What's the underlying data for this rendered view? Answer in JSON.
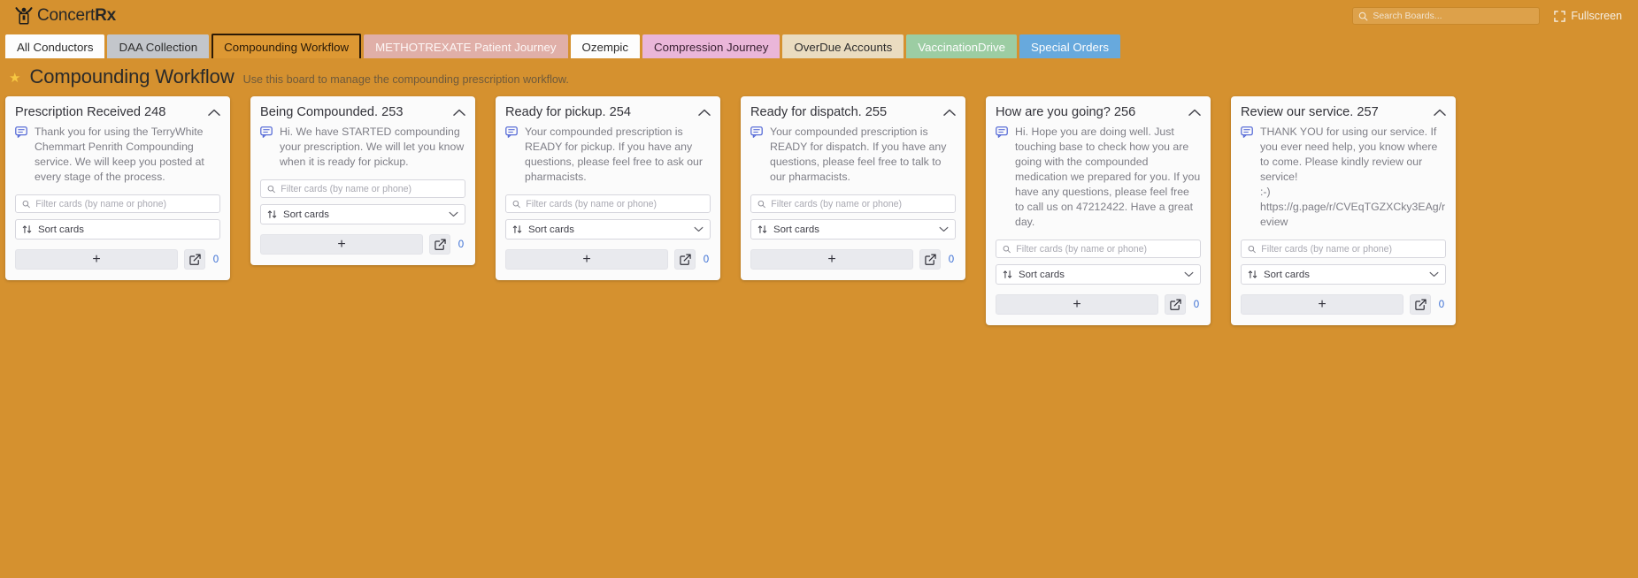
{
  "app": {
    "brand_prefix": "Concert",
    "brand_suffix": "Rx",
    "logo_icon": "person-raising-arms-logo"
  },
  "header": {
    "search": {
      "placeholder": "Search Boards...",
      "value": "",
      "icon": "search-icon"
    },
    "fullscreen": {
      "label": "Fullscreen",
      "icon": "fullscreen-icon"
    }
  },
  "tabs": [
    {
      "label": "All Conductors",
      "bg": "#fdfdfd",
      "fg": "#2d2d2d",
      "active": false
    },
    {
      "label": "DAA Collection",
      "bg": "#c3c6cb",
      "fg": "#2d2d2d",
      "active": false
    },
    {
      "label": "Compounding Workflow",
      "bg": "#dd9833",
      "fg": "#2a1a07",
      "active": true
    },
    {
      "label": "METHOTREXATE Patient Journey",
      "bg": "#e0afa8",
      "fg": "#fdf7f6",
      "active": false
    },
    {
      "label": "Ozempic",
      "bg": "#fdfdfd",
      "fg": "#2d2d2d",
      "active": false
    },
    {
      "label": "Compression Journey",
      "bg": "#eab6d9",
      "fg": "#3a2233",
      "active": false
    },
    {
      "label": "OverDue Accounts",
      "bg": "#eadcc0",
      "fg": "#2d2d2d",
      "active": false
    },
    {
      "label": "VaccinationDrive",
      "bg": "#9ccda3",
      "fg": "#fdfdfd",
      "active": false
    },
    {
      "label": "Special Orders",
      "bg": "#67a9dd",
      "fg": "#fdfdfd",
      "active": false
    }
  ],
  "board": {
    "star_icon": "star-icon",
    "title": "Compounding Workflow",
    "subtitle": "Use this board to manage the compounding prescription workflow."
  },
  "common": {
    "filter_placeholder": "Filter cards (by name or phone)",
    "sort_label": "Sort cards",
    "add_icon": "plus-icon",
    "edit_icon": "edit-square-icon",
    "collapse_icon": "chevron-up-icon",
    "message_icon": "speech-bubble-icon",
    "filter_icon": "search-icon",
    "sort_icon": "sort-arrows-icon",
    "chevron_icon": "chevron-down-icon",
    "accent_count_color": "#3b6fd4"
  },
  "columns": [
    {
      "title": "Prescription Received 248",
      "message": "Thank you for using the TerryWhite Chemmart Penrith Compounding service. We will keep you posted at every stage of the process.",
      "filter_value": "",
      "count": "0",
      "has_sort_chevron": false
    },
    {
      "title": "Being Compounded. 253",
      "message": "Hi. We have STARTED compounding your prescription. We will let you know when it is ready for pickup.",
      "filter_value": "",
      "count": "0",
      "has_sort_chevron": true
    },
    {
      "title": "Ready for pickup. 254",
      "message": "Your compounded prescription is READY for pickup. If you have any questions, please feel free to ask our pharmacists.",
      "filter_value": "",
      "count": "0",
      "has_sort_chevron": true
    },
    {
      "title": "Ready for dispatch. 255",
      "message": "Your compounded prescription is READY for dispatch. If you have any questions, please feel free to talk to our pharmacists.",
      "filter_value": "",
      "count": "0",
      "has_sort_chevron": true
    },
    {
      "title": "How are you going? 256",
      "message": "Hi. Hope you are doing well. Just touching base to check how you are going with the compounded medication we prepared for you. If you have any questions, please feel free to call us on 47212422. Have a great day.",
      "filter_value": "",
      "count": "0",
      "has_sort_chevron": true
    },
    {
      "title": "Review our service. 257",
      "message": "THANK YOU for using our service. If you ever need help, you know where to come. Please kindly review our service!\n:-) https://g.page/r/CVEqTGZXCky3EAg/review",
      "filter_value": "",
      "count": "0",
      "has_sort_chevron": true
    }
  ]
}
